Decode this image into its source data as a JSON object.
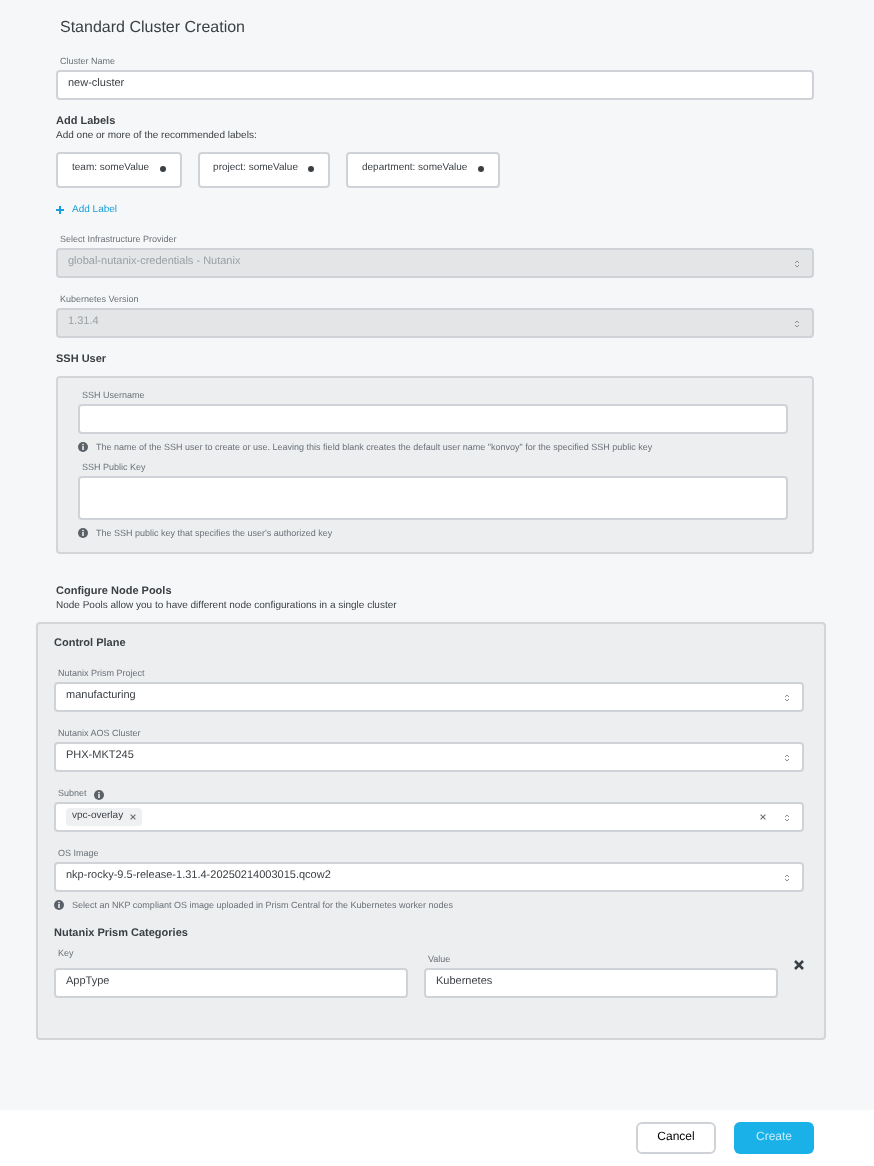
{
  "title": "Standard Cluster Creation",
  "cluster_name": {
    "label": "Cluster Name",
    "value": "new-cluster"
  },
  "labels": {
    "heading": "Add Labels",
    "subtitle": "Add one or more of the recommended labels:",
    "chips": [
      "team: someValue",
      "project: someValue",
      "department: someValue"
    ],
    "add_label": "Add Label"
  },
  "infrastructure_provider": {
    "label": "Select Infrastructure Provider",
    "value": "global-nutanix-credentials - Nutanix",
    "disabled": true
  },
  "kubernetes_version": {
    "label": "Kubernetes Version",
    "value": "1.31.4",
    "disabled": true
  },
  "ssh_user": {
    "heading": "SSH User",
    "username_label": "SSH Username",
    "username_hint": "The name of the SSH user to create or use. Leaving this field blank creates the default user name \"konvoy\" for the specified SSH public key",
    "public_key_label": "SSH Public Key",
    "public_key_hint": "The SSH public key that specifies the user's authorized key"
  },
  "node_pools": {
    "heading": "Configure Node Pools",
    "description": "Node Pools allow you to have different node configurations in a single cluster",
    "control_plane": {
      "heading": "Control Plane",
      "fields": [
        {
          "kind": "select",
          "label": "Nutanix Prism Project",
          "value": "manufacturing",
          "info": false
        },
        {
          "kind": "select",
          "label": "Nutanix AOS Cluster",
          "value": "PHX-MKT245",
          "info": false
        },
        {
          "kind": "multiselect",
          "label": "Subnet",
          "tags": [
            "vpc-overlay"
          ],
          "info": true
        },
        {
          "kind": "select",
          "label": "OS Image",
          "value": "nkp-rocky-9.5-release-1.31.4-20250214003015.qcow2",
          "info": false,
          "hint": "Select an NKP compliant OS image uploaded in Prism Central for the Kubernetes worker nodes"
        }
      ],
      "categories": {
        "heading": "Nutanix Prism Categories",
        "key_label": "Key",
        "value_label": "Value",
        "rows": [
          {
            "key": "AppType",
            "value": "Kubernetes"
          }
        ]
      }
    }
  },
  "footer": {
    "cancel": "Cancel",
    "create": "Create"
  }
}
